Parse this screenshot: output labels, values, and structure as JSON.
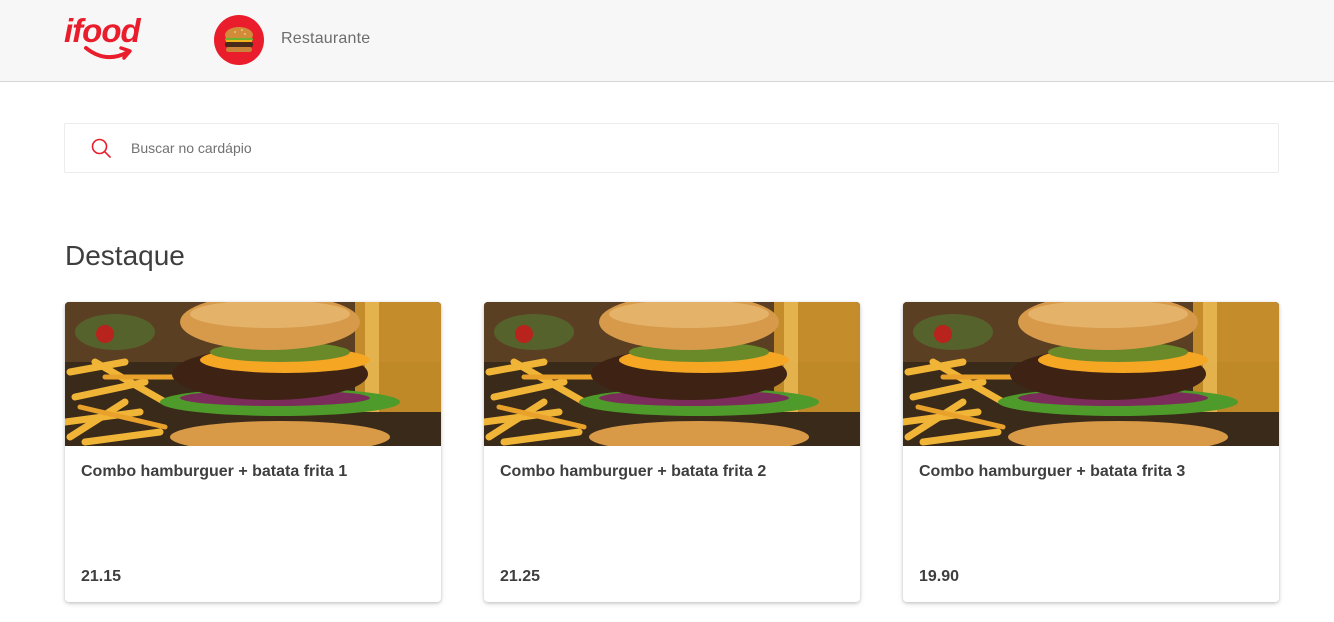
{
  "header": {
    "logo_text": "ifood",
    "restaurant_name": "Restaurante"
  },
  "search": {
    "placeholder": "Buscar no cardápio",
    "value": ""
  },
  "section": {
    "title": "Destaque"
  },
  "products": [
    {
      "title": "Combo hamburguer + batata frita 1",
      "price": "21.15"
    },
    {
      "title": "Combo hamburguer + batata frita 2",
      "price": "21.25"
    },
    {
      "title": "Combo hamburguer + batata frita 3",
      "price": "19.90"
    }
  ],
  "colors": {
    "brand": "#ea1d2c",
    "header_bg": "#f7f7f7",
    "text": "#3e3e3e"
  },
  "icons": {
    "logo": "ifood-logo",
    "avatar": "burger-avatar",
    "search": "search-icon"
  }
}
